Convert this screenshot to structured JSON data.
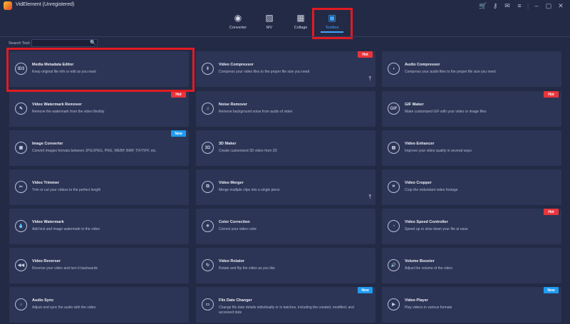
{
  "app": {
    "title": "VidElement (Unregistered)"
  },
  "window_controls": [
    "cart-icon",
    "key-icon",
    "feedback-icon",
    "menu-icon",
    "minimize-icon",
    "maximize-icon",
    "close-icon"
  ],
  "nav": {
    "tabs": [
      {
        "label": "Converter",
        "icon": "converter-icon",
        "glyph": "◉",
        "active": false
      },
      {
        "label": "MV",
        "icon": "mv-icon",
        "glyph": "▨",
        "active": false
      },
      {
        "label": "Collage",
        "icon": "collage-icon",
        "glyph": "▦",
        "active": false
      },
      {
        "label": "Toolbox",
        "icon": "toolbox-icon",
        "glyph": "▣",
        "active": true
      }
    ]
  },
  "search": {
    "label": "Search Tool:",
    "value": "",
    "placeholder": ""
  },
  "tools": [
    {
      "title": "Media Metadata Editor",
      "desc": "Keep original file info or edit as you want",
      "icon": "id3-icon",
      "glyph": "ID3",
      "badge": ""
    },
    {
      "title": "Video Compressor",
      "desc": "Compress your video files to the proper file size you need",
      "icon": "compress-icon",
      "glyph": "⇕",
      "badge": "Hot",
      "pinned": true
    },
    {
      "title": "Audio Compressor",
      "desc": "Compress your audio files to the proper file size you need",
      "icon": "audio-compress-icon",
      "glyph": "◖",
      "badge": ""
    },
    {
      "title": "Video Watermark Remover",
      "desc": "Remove the watermark from the video flexibly",
      "icon": "watermark-remove-icon",
      "glyph": "✎",
      "badge": "Hot"
    },
    {
      "title": "Noise Remover",
      "desc": "Remove background noise from audio of video",
      "icon": "noise-icon",
      "glyph": "♫",
      "badge": ""
    },
    {
      "title": "GIF Maker",
      "desc": "Make customized GIF with your video or image files",
      "icon": "gif-icon",
      "glyph": "GIF",
      "badge": "Hot"
    },
    {
      "title": "Image Converter",
      "desc": "Convert images formats between JPG/JPEG, PNG, WEBP, BMP, TIF/TIFF, etc.",
      "icon": "image-convert-icon",
      "glyph": "▣",
      "badge": "New"
    },
    {
      "title": "3D Maker",
      "desc": "Create customized 3D video from 2D",
      "icon": "3d-icon",
      "glyph": "3D",
      "badge": ""
    },
    {
      "title": "Video Enhancer",
      "desc": "Improve your video quality in several ways",
      "icon": "enhance-icon",
      "glyph": "▤",
      "badge": ""
    },
    {
      "title": "Video Trimmer",
      "desc": "Trim or cut your videos to the perfect length",
      "icon": "trim-icon",
      "glyph": "✂",
      "badge": ""
    },
    {
      "title": "Video Merger",
      "desc": "Merge multiple clips into a single piece",
      "icon": "merge-icon",
      "glyph": "⧉",
      "badge": "",
      "pinned": true
    },
    {
      "title": "Video Cropper",
      "desc": "Crop the redundant video footage",
      "icon": "crop-icon",
      "glyph": "⌗",
      "badge": ""
    },
    {
      "title": "Video Watermark",
      "desc": "Add text and image watermark to the video",
      "icon": "watermark-icon",
      "glyph": "💧",
      "badge": ""
    },
    {
      "title": "Color Correction",
      "desc": "Correct your video color",
      "icon": "color-icon",
      "glyph": "☀",
      "badge": ""
    },
    {
      "title": "Video Speed Controller",
      "desc": "Speed up or slow down your file at ease",
      "icon": "speed-icon",
      "glyph": "◔",
      "badge": "Hot"
    },
    {
      "title": "Video Reverser",
      "desc": "Reverse your video and turn it backwards",
      "icon": "reverse-icon",
      "glyph": "◀◀",
      "badge": ""
    },
    {
      "title": "Video Rotator",
      "desc": "Rotate and flip the video as you like",
      "icon": "rotate-icon",
      "glyph": "↻",
      "badge": ""
    },
    {
      "title": "Volume Booster",
      "desc": "Adjust the volume of the video",
      "icon": "volume-icon",
      "glyph": "🔊",
      "badge": ""
    },
    {
      "title": "Audio Sync",
      "desc": "Adjust and sync the audio with the video",
      "icon": "audio-sync-icon",
      "glyph": "♪",
      "badge": ""
    },
    {
      "title": "File Date Changer",
      "desc": "Change file date details individually or in batches, including the created, modified, and accessed date",
      "icon": "file-date-icon",
      "glyph": "▭",
      "badge": "New"
    },
    {
      "title": "Video Player",
      "desc": "Play videos in various formats",
      "icon": "player-icon",
      "glyph": "▶",
      "badge": "New"
    }
  ],
  "colors": {
    "background": "#232a45",
    "card": "#2d3556",
    "accent": "#3fa5ff",
    "hot": "#e8353b",
    "new": "#1f9bef",
    "highlight": "#e11b22"
  }
}
